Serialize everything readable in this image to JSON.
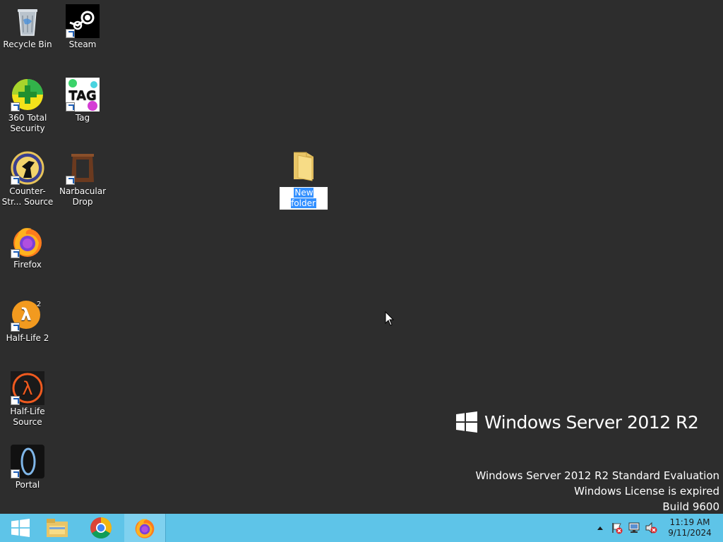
{
  "desktop": {
    "icons": [
      {
        "label": "Recycle Bin",
        "icon": "recycle-bin-icon"
      },
      {
        "label": "Steam",
        "icon": "steam-icon"
      },
      {
        "label": "360 Total Security",
        "icon": "360-total-security-icon"
      },
      {
        "label": "Tag",
        "icon": "tag-icon"
      },
      {
        "label": "Counter-Str... Source",
        "icon": "counter-strike-icon"
      },
      {
        "label": "Narbacular Drop",
        "icon": "narbacular-drop-icon"
      },
      {
        "label": "Firefox",
        "icon": "firefox-icon"
      },
      {
        "label": "Half-Life 2",
        "icon": "half-life-2-icon"
      },
      {
        "label": "Half-Life Source",
        "icon": "half-life-source-icon"
      },
      {
        "label": "Portal",
        "icon": "portal-icon"
      }
    ],
    "new_folder": {
      "label": "New folder",
      "icon": "folder-icon"
    }
  },
  "branding": {
    "logo_text": "Windows Server 2012 R2"
  },
  "watermark": {
    "line1": "Windows Server 2012 R2 Standard Evaluation",
    "line2": "Windows License is expired",
    "line3": "Build 9600"
  },
  "taskbar": {
    "buttons": [
      {
        "name": "start",
        "icon": "windows-start-icon"
      },
      {
        "name": "file-explorer",
        "icon": "file-explorer-icon"
      },
      {
        "name": "chrome",
        "icon": "chrome-icon"
      },
      {
        "name": "firefox",
        "icon": "firefox-icon",
        "active": true
      }
    ],
    "tray": {
      "time": "11:19 AM",
      "date": "9/11/2024",
      "icons": [
        "show-hidden-icons-icon",
        "action-center-flag-icon",
        "network-icon",
        "volume-muted-icon"
      ]
    },
    "color": "#5ec4e8"
  },
  "colors": {
    "desktop_bg": "#2d2d2d",
    "selection": "#3390ff"
  }
}
